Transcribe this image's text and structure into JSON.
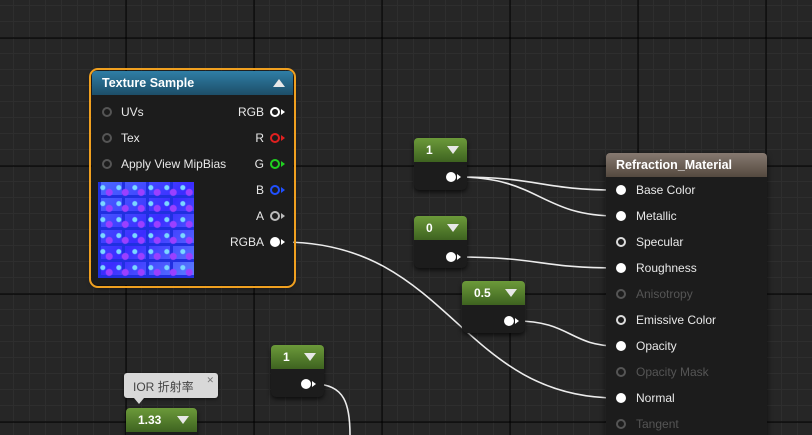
{
  "texture_node": {
    "title": "Texture Sample",
    "inputs": [
      "UVs",
      "Tex",
      "Apply View MipBias"
    ],
    "outputs": [
      "RGB",
      "R",
      "G",
      "B",
      "A",
      "RGBA"
    ],
    "output_colors": [
      "#ffffff",
      "#e02020",
      "#20d020",
      "#2050ff",
      "#dddddd",
      "#ffffff"
    ]
  },
  "material_node": {
    "title": "Refraction_Material",
    "inputs": [
      "Base Color",
      "Metallic",
      "Specular",
      "Roughness",
      "Anisotropy",
      "Emissive Color",
      "Opacity",
      "Opacity Mask",
      "Normal",
      "Tangent"
    ]
  },
  "constants": [
    "1",
    "0",
    "0.5",
    "1",
    "1.33"
  ],
  "comment": {
    "text": "IOR 折射率"
  },
  "colors": {
    "selection": "#f0a020",
    "constant_header": "#5a8a2e",
    "material_header": "#6e625a",
    "texture_header": "#2a6a8a"
  }
}
